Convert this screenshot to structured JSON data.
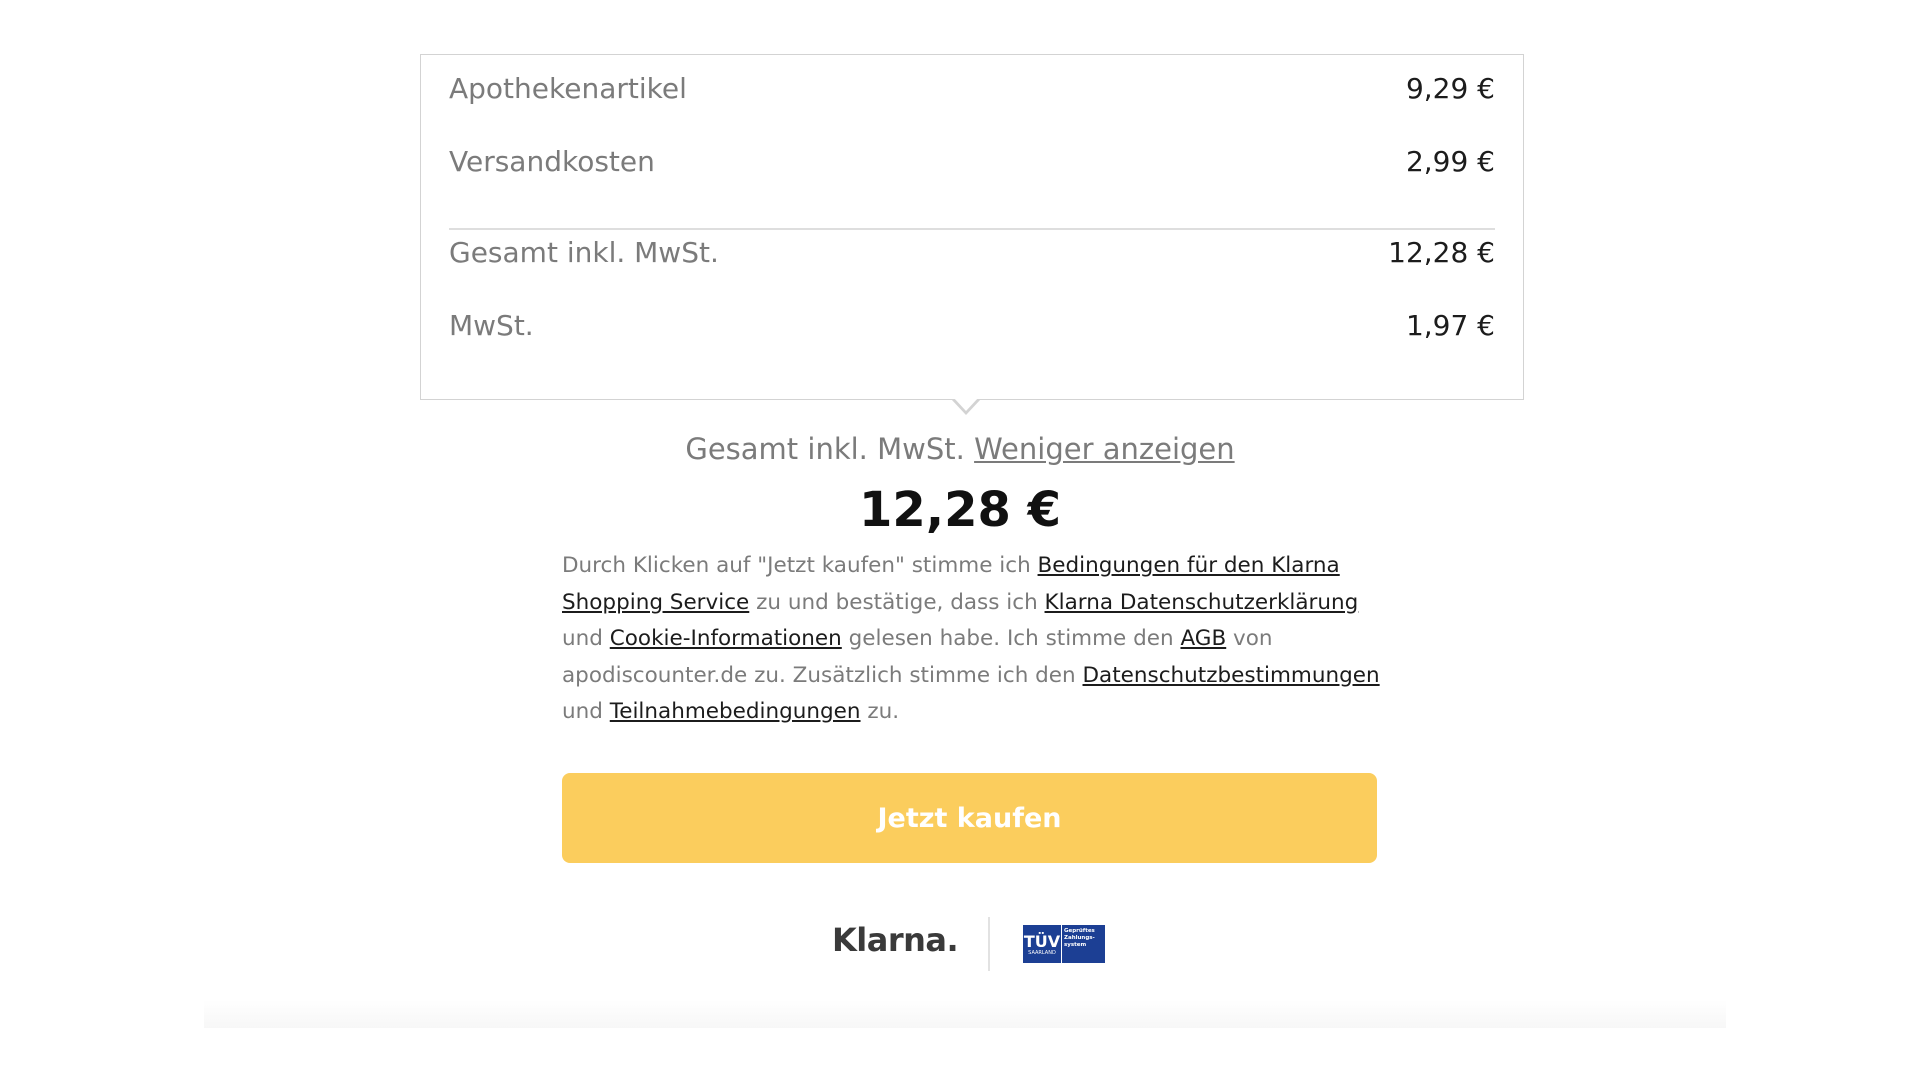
{
  "summary": {
    "rows": [
      {
        "label": "Apothekenartikel",
        "value": "9,29 €"
      },
      {
        "label": "Versandkosten",
        "value": "2,99 €"
      },
      {
        "label": "Gesamt inkl. MwSt.",
        "value": "12,28 €"
      },
      {
        "label": "MwSt.",
        "value": "1,97 €"
      }
    ]
  },
  "total": {
    "label": "Gesamt inkl. MwSt.",
    "toggle_label": "Weniger anzeigen",
    "amount": "12,28 €"
  },
  "legal": {
    "t1": "Durch Klicken auf \"Jetzt kaufen\" stimme ich ",
    "link_terms": "Bedingungen für den Klarna Shopping Service",
    "t2": " zu und bestätige, dass ich ",
    "link_privacy": "Klarna Datenschutzerklärung",
    "t3": " und ",
    "link_cookies": "Cookie-Informationen",
    "t4": " gelesen habe. Ich stimme den ",
    "link_agb": "AGB",
    "t5": " von apodiscounter.de zu. Zusätzlich stimme ich den ",
    "link_data_protection": "Datenschutzbestimmungen",
    "t6": " und ",
    "link_participation": "Teilnahmebedingungen",
    "t7": " zu."
  },
  "buy_button": {
    "label": "Jetzt kaufen"
  },
  "colors": {
    "button_bg": "#fbcd5d",
    "button_text": "#ffffff",
    "tuv_blue": "#1c3f94"
  },
  "trust": {
    "klarna_logo": "Klarna.",
    "tuv_logo": {
      "name": "TÜV",
      "region": "SAARLAND",
      "text": "Geprüftes Zahlungs-system"
    }
  }
}
